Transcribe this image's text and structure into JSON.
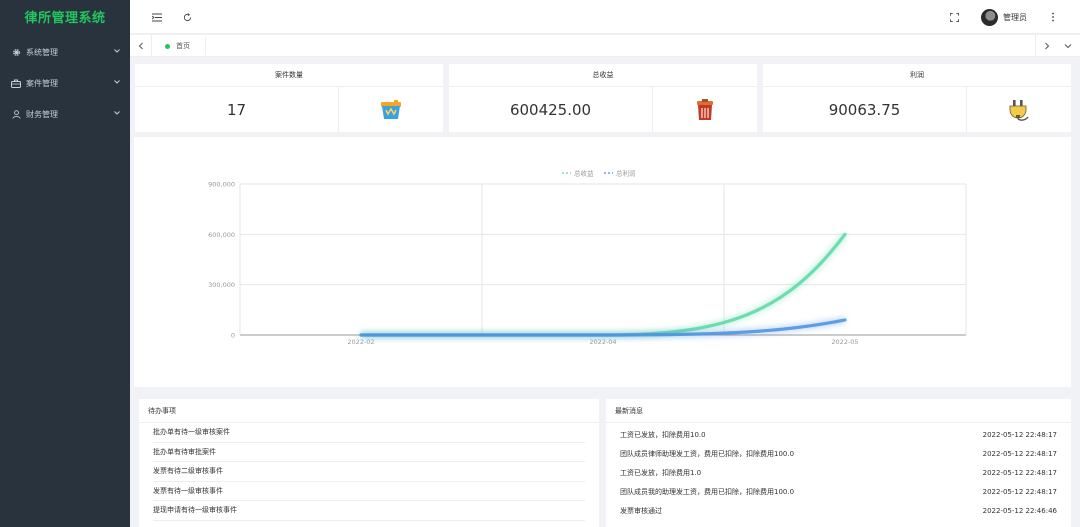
{
  "app": {
    "title": "律所管理系统",
    "brand_color": "#22c55e"
  },
  "sidebar": {
    "items": [
      {
        "label": "系统管理",
        "icon": "gear-icon"
      },
      {
        "label": "案件管理",
        "icon": "briefcase-icon"
      },
      {
        "label": "财务管理",
        "icon": "person-icon"
      }
    ]
  },
  "header": {
    "icons": [
      "menu-fold-icon",
      "refresh-icon",
      "fullscreen-icon",
      "more-icon"
    ],
    "user": {
      "name": "管理员"
    }
  },
  "tabs": {
    "items": [
      {
        "label": "首页",
        "active": true
      }
    ]
  },
  "stats": [
    {
      "title": "案件数量",
      "value": "17",
      "icon": "paint-bucket-icon"
    },
    {
      "title": "总收益",
      "value": "600425.00",
      "icon": "trash-can-icon"
    },
    {
      "title": "利润",
      "value": "90063.75",
      "icon": "plug-icon"
    }
  ],
  "chart_data": {
    "type": "line",
    "x": [
      "2022-02",
      "2022-04",
      "2022-05"
    ],
    "yticks": [
      "900,000",
      "600,000",
      "300,000",
      "0"
    ],
    "ylim": [
      0,
      900000
    ],
    "series": [
      {
        "name": "总收益",
        "values": [
          0,
          0,
          600425
        ],
        "color": "#5ad8a6"
      },
      {
        "name": "总利润",
        "values": [
          0,
          0,
          90063.75
        ],
        "color": "#4a90e2"
      }
    ],
    "legend": "top-center",
    "grid": true
  },
  "todo": {
    "title": "待办事项",
    "items": [
      "批办单有待一级审核案件",
      "批办单有待审批案件",
      "发票有待二级审核事件",
      "发票有待一级审核事件",
      "提现申请有待一级审核事件"
    ]
  },
  "messages": {
    "title": "最新消息",
    "items": [
      {
        "text": "工资已发放，扣除费用10.0",
        "time": "2022-05-12 22:48:17"
      },
      {
        "text": "团队成员律师助理发工资，费用已扣除，扣除费用100.0",
        "time": "2022-05-12 22:48:17"
      },
      {
        "text": "工资已发放，扣除费用1.0",
        "time": "2022-05-12 22:48:17"
      },
      {
        "text": "团队成员我的助理发工资，费用已扣除，扣除费用100.0",
        "time": "2022-05-12 22:48:17"
      },
      {
        "text": "发票审核通过",
        "time": "2022-05-12 22:46:46"
      }
    ]
  }
}
